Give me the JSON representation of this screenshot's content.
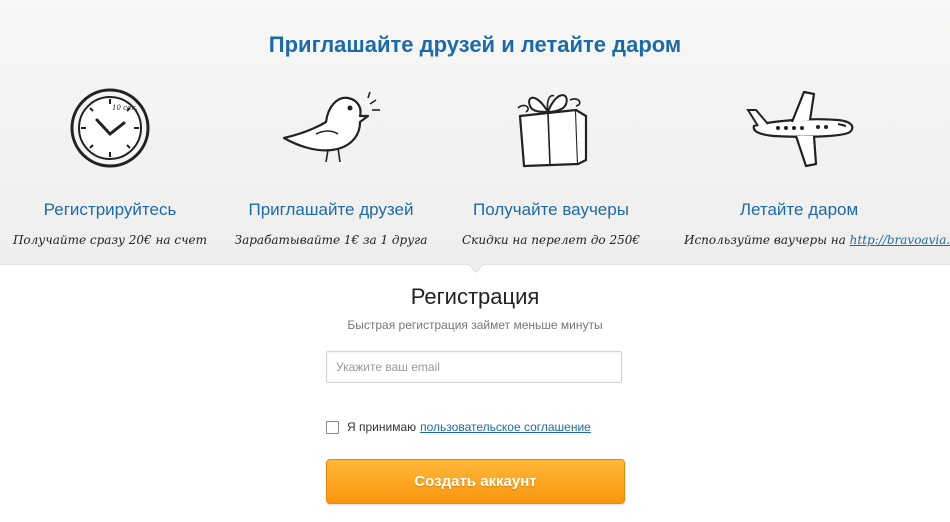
{
  "hero": {
    "title": "Приглашайте друзей и летайте даром",
    "steps": [
      {
        "icon": "clock-icon",
        "title": "Регистрируйтесь",
        "desc": "Получайте сразу 20€ на счет"
      },
      {
        "icon": "bird-icon",
        "title": "Приглашайте друзей",
        "desc": "Зарабатывайте 1€ за 1 друга"
      },
      {
        "icon": "gift-icon",
        "title": "Получайте ваучеры",
        "desc": "Скидки на перелет до 250€"
      },
      {
        "icon": "airplane-icon",
        "title": "Летайте даром",
        "desc": "Используйте ваучеры на",
        "link": "http://bravoavia.ru"
      }
    ],
    "clock_label": "10 сек."
  },
  "registration": {
    "title": "Регистрация",
    "subtitle": "Быстрая регистрация займет меньше минуты",
    "email_placeholder": "Укажите ваш email",
    "email_value": "",
    "agree_text": "Я принимаю",
    "agree_link": "пользовательское соглашение",
    "agree_checked": false,
    "submit_label": "Создать аккаунт"
  },
  "colors": {
    "accent": "#1e6aa6",
    "button": "#f9960f"
  }
}
